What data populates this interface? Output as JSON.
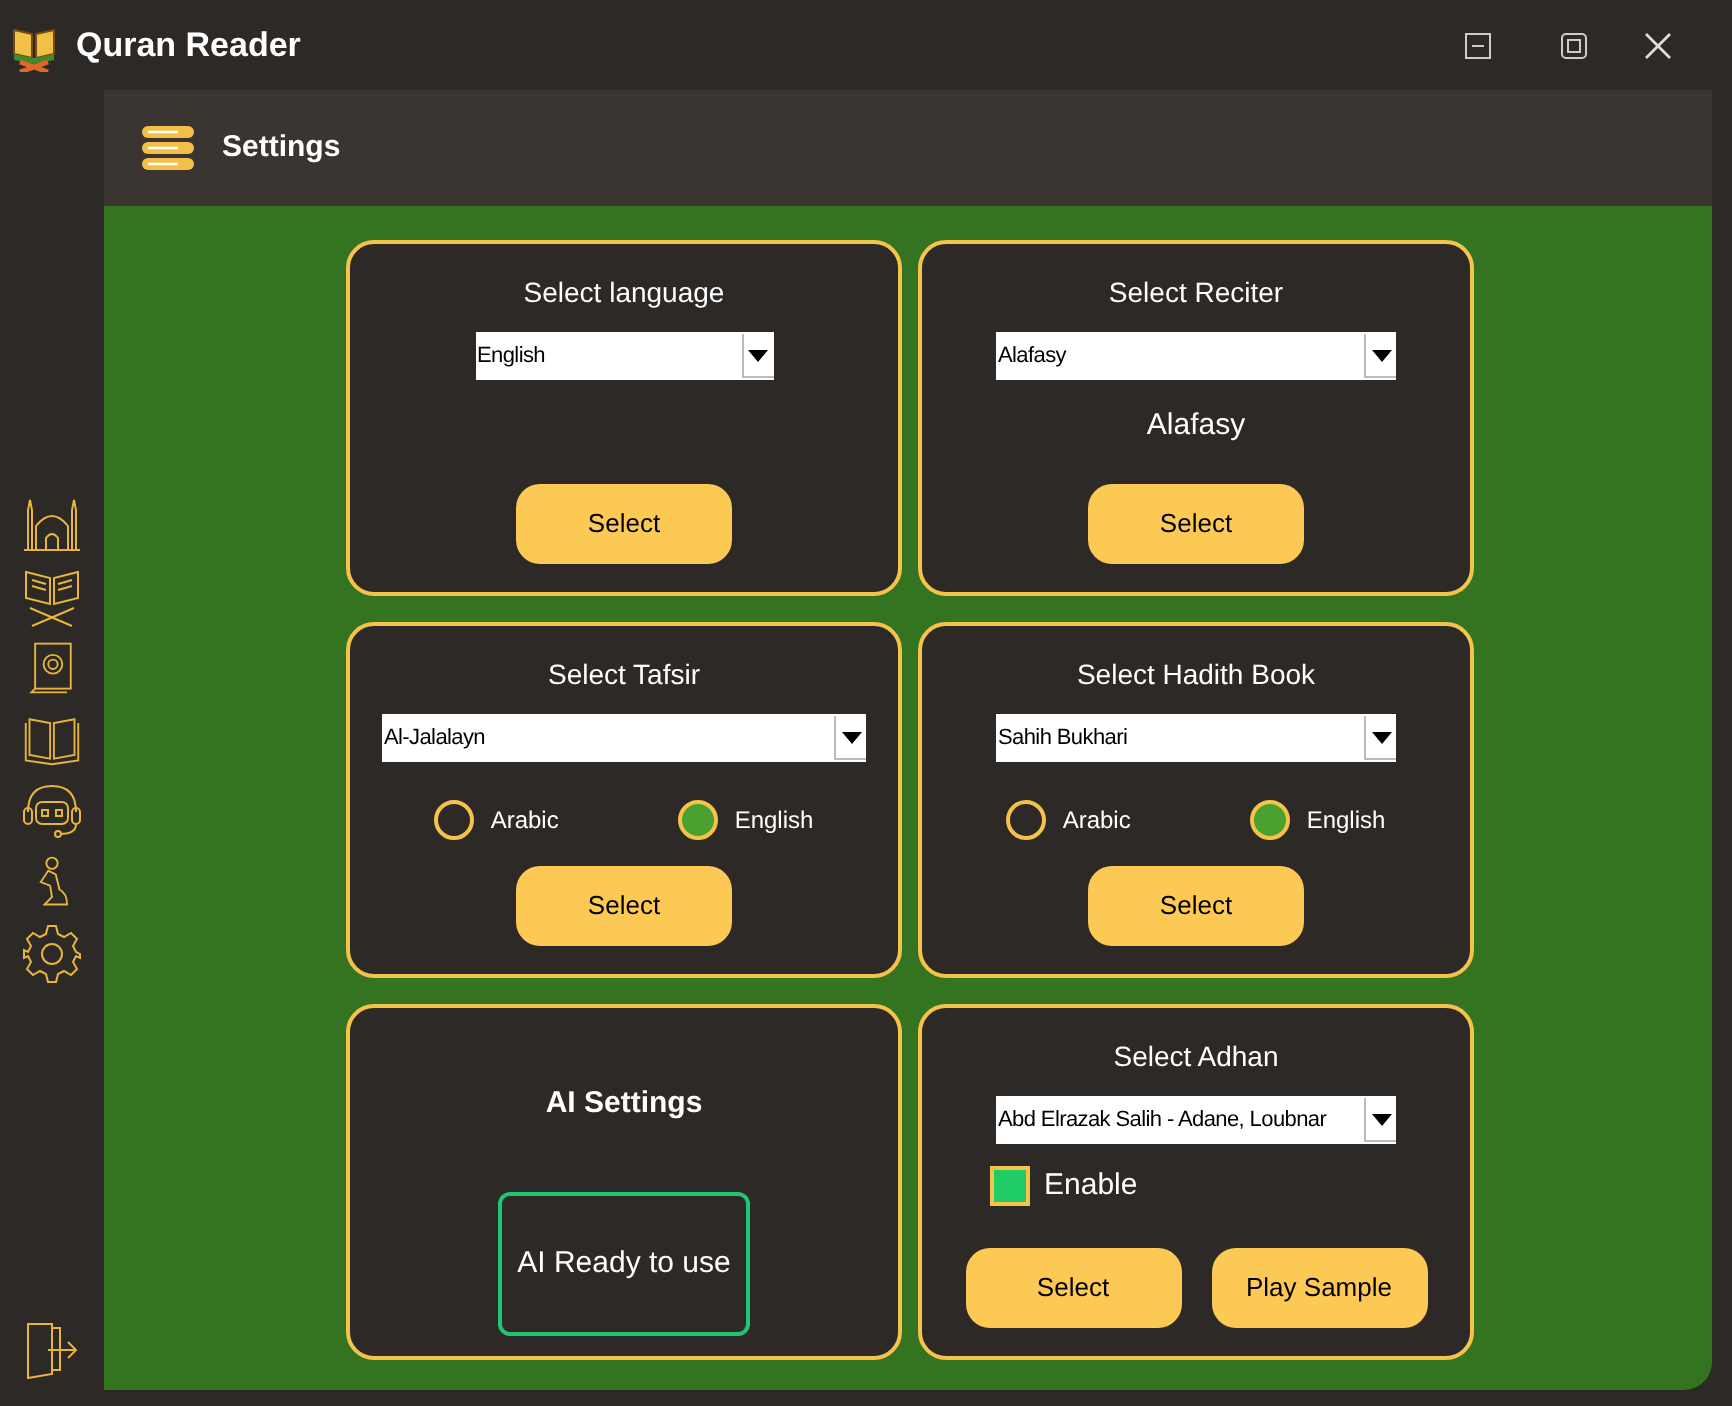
{
  "window": {
    "title": "Quran Reader"
  },
  "header": {
    "title": "Settings"
  },
  "cards": [
    {
      "kind": "language",
      "items": [
        {
          "kind": "heading",
          "text": "Select language"
        },
        {
          "kind": "dropdown",
          "value": "English"
        },
        {
          "kind": "buttons",
          "buttons": [
            "Select"
          ]
        }
      ]
    },
    {
      "kind": "reciter",
      "items": [
        {
          "kind": "heading",
          "text": "Select Reciter"
        },
        {
          "kind": "dropdown",
          "value": "Alafasy"
        },
        {
          "kind": "text",
          "text": "Alafasy"
        },
        {
          "kind": "buttons",
          "buttons": [
            "Select"
          ]
        }
      ]
    },
    {
      "kind": "tafsir",
      "items": [
        {
          "kind": "heading",
          "text": "Select Tafsir"
        },
        {
          "kind": "dropdown",
          "value": "Al-Jalalayn"
        },
        {
          "kind": "radios",
          "options": [
            {
              "label": "Arabic",
              "selected": false
            },
            {
              "label": "English",
              "selected": true
            }
          ]
        },
        {
          "kind": "buttons",
          "buttons": [
            "Select"
          ]
        }
      ]
    },
    {
      "kind": "hadith",
      "items": [
        {
          "kind": "heading",
          "text": "Select Hadith Book"
        },
        {
          "kind": "dropdown",
          "value": "Sahih Bukhari"
        },
        {
          "kind": "radios",
          "options": [
            {
              "label": "Arabic",
              "selected": false
            },
            {
              "label": "English",
              "selected": true
            }
          ]
        },
        {
          "kind": "buttons",
          "buttons": [
            "Select"
          ]
        }
      ]
    },
    {
      "kind": "ai",
      "items": [
        {
          "kind": "bold_heading",
          "text": "AI Settings"
        },
        {
          "kind": "status",
          "text": "AI Ready to use"
        }
      ]
    },
    {
      "kind": "adhan",
      "items": [
        {
          "kind": "heading",
          "text": "Select Adhan"
        },
        {
          "kind": "dropdown",
          "value": "Abd Elrazak Salih - Adane, Loubnar"
        },
        {
          "kind": "checkbox",
          "label": "Enable",
          "checked": true
        },
        {
          "kind": "buttons",
          "buttons": [
            "Select",
            "Play Sample"
          ]
        }
      ]
    }
  ]
}
